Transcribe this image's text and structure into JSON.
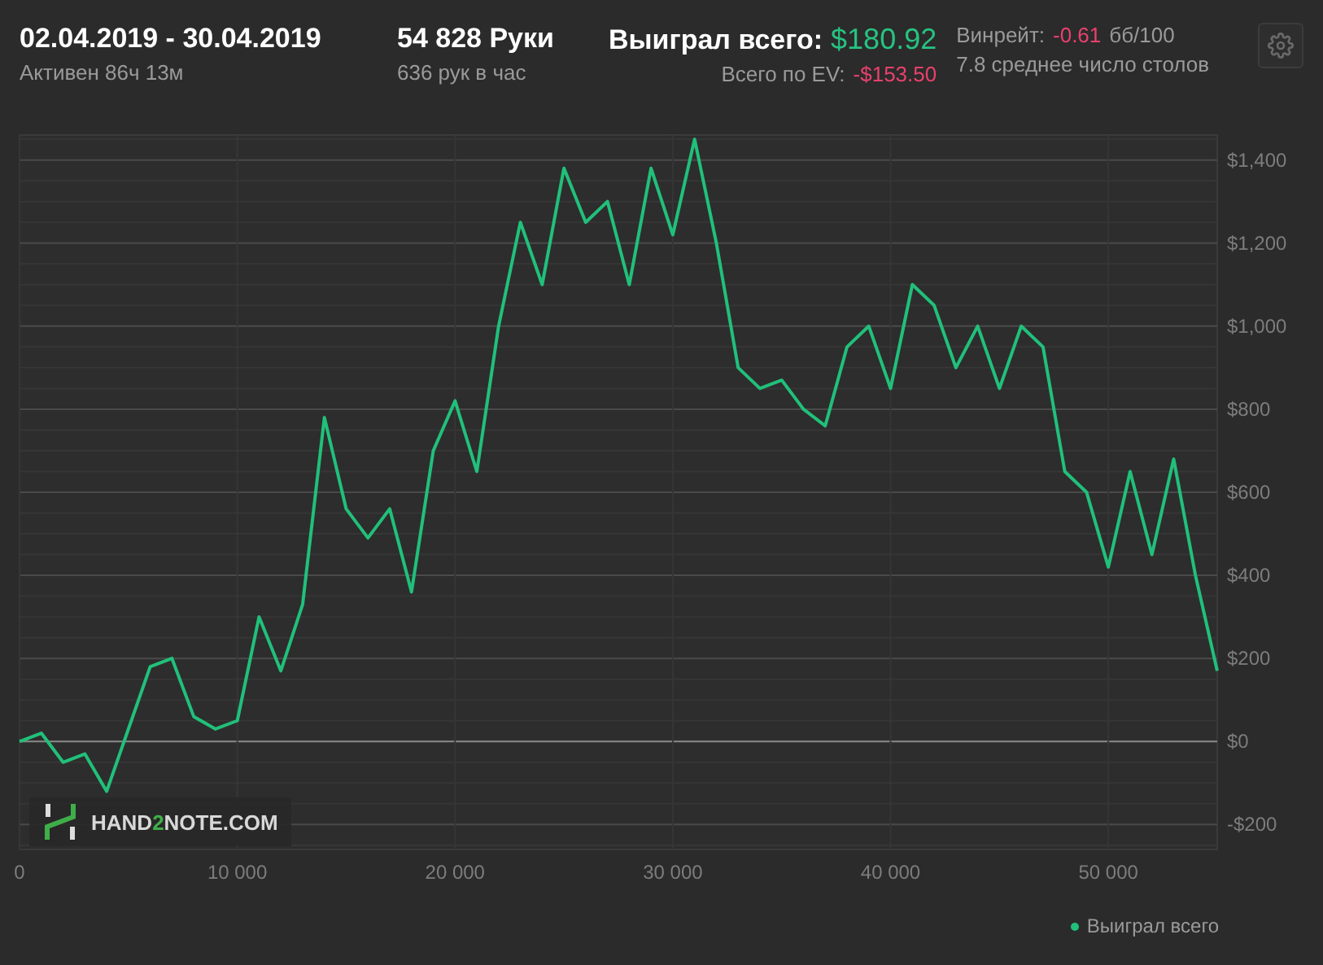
{
  "header": {
    "date_range": "02.04.2019 - 30.04.2019",
    "active_time": "Активен 86ч 13м",
    "hands": "54 828 Руки",
    "hands_per_hour": "636 рук в час",
    "won_label": "Выиграл всего:",
    "won_value": "$180.92",
    "ev_label": "Всего по EV:",
    "ev_value": "-$153.50",
    "winrate_label": "Винрейт:",
    "winrate_value": "-0.61",
    "winrate_unit": "бб/100",
    "tables": "7.8 среднее число столов"
  },
  "logo": {
    "part_1": "HAND",
    "part_2": "2",
    "part_3": "NOTE.COM"
  },
  "chart": {
    "chart_data": {
      "type": "line",
      "x": [
        0,
        1000,
        2000,
        3000,
        4000,
        5000,
        6000,
        7000,
        8000,
        9000,
        10000,
        11000,
        12000,
        13000,
        14000,
        15000,
        16000,
        17000,
        18000,
        19000,
        20000,
        21000,
        22000,
        23000,
        24000,
        25000,
        26000,
        27000,
        28000,
        29000,
        30000,
        31000,
        32000,
        33000,
        34000,
        35000,
        36000,
        37000,
        38000,
        39000,
        40000,
        41000,
        42000,
        43000,
        44000,
        45000,
        46000,
        47000,
        48000,
        49000,
        50000,
        51000,
        52000,
        53000,
        54000,
        55000
      ],
      "series": [
        {
          "name": "Выиграл всего",
          "color": "#21c07a",
          "values": [
            0,
            20,
            -50,
            -30,
            -120,
            30,
            180,
            200,
            60,
            30,
            50,
            300,
            170,
            330,
            780,
            560,
            490,
            560,
            360,
            700,
            820,
            650,
            1000,
            1250,
            1100,
            1380,
            1250,
            1300,
            1100,
            1380,
            1220,
            1450,
            1200,
            900,
            850,
            870,
            800,
            760,
            950,
            1000,
            850,
            1100,
            1050,
            900,
            1000,
            850,
            1000,
            950,
            650,
            600,
            420,
            650,
            450,
            680,
            400,
            170
          ]
        }
      ],
      "grid": true,
      "xlim": [
        0,
        55000
      ],
      "ylim": [
        -260,
        1460
      ],
      "xticks": [
        {
          "value": 0,
          "label": "0"
        },
        {
          "value": 10000,
          "label": "10 000"
        },
        {
          "value": 20000,
          "label": "20 000"
        },
        {
          "value": 30000,
          "label": "30 000"
        },
        {
          "value": 40000,
          "label": "40 000"
        },
        {
          "value": 50000,
          "label": "50 000"
        }
      ],
      "yticks": [
        {
          "value": -200,
          "label": "-$200"
        },
        {
          "value": 0,
          "label": "$0"
        },
        {
          "value": 200,
          "label": "$200"
        },
        {
          "value": 400,
          "label": "$400"
        },
        {
          "value": 600,
          "label": "$600"
        },
        {
          "value": 800,
          "label": "$800"
        },
        {
          "value": 1000,
          "label": "$1,000"
        },
        {
          "value": 1200,
          "label": "$1,200"
        },
        {
          "value": 1400,
          "label": "$1,400"
        }
      ]
    }
  }
}
